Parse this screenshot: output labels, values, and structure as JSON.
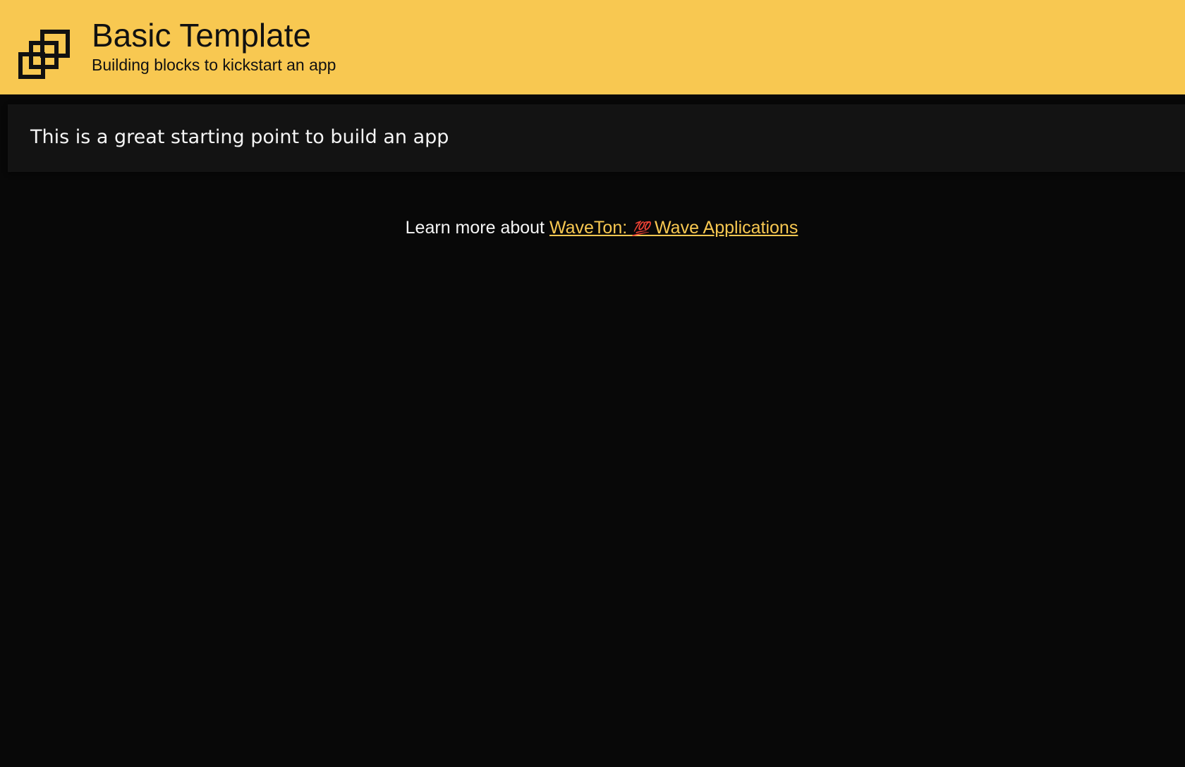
{
  "header": {
    "title": "Basic Template",
    "subtitle": "Building blocks to kickstart an app",
    "logo_icon": "overlapping-squares-icon",
    "background_color": "#f8c851"
  },
  "card": {
    "text": "This is a great starting point to build an app"
  },
  "footer": {
    "prefix": "Learn more about ",
    "link_part1": "WaveTon: ",
    "link_emoji": "💯",
    "link_part2": " Wave Applications",
    "link_color": "#f8c851"
  }
}
